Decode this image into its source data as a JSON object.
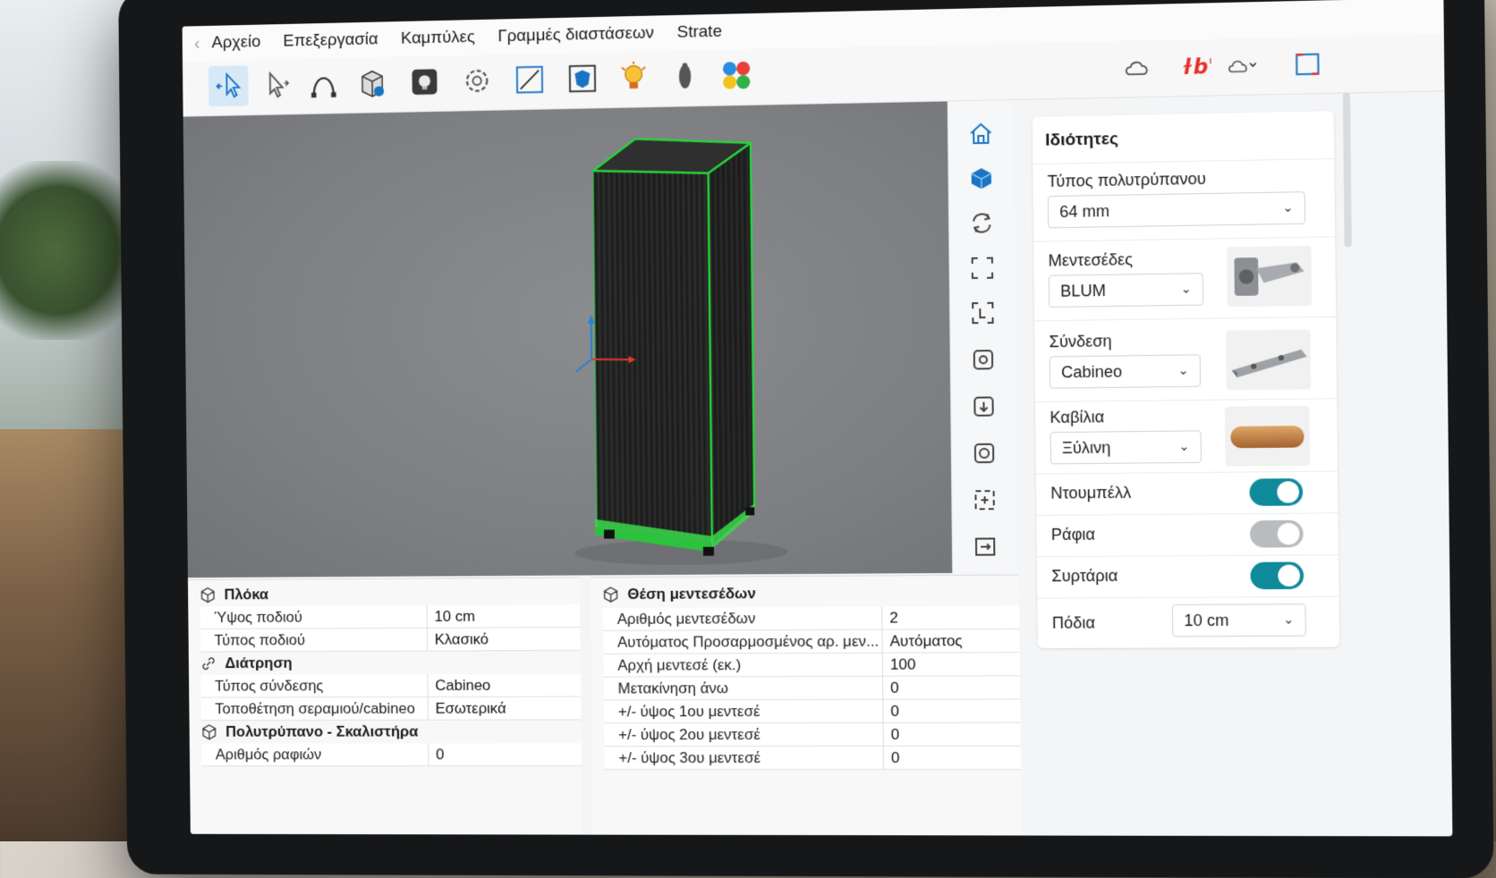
{
  "menu": {
    "items": [
      "Αρχείο",
      "Επεξεργασία",
      "Καμπύλες",
      "Γραμμές διαστάσεων",
      "Strate"
    ]
  },
  "toolbar": {
    "tools": [
      {
        "icon": "select-arrow-icon",
        "active": true
      },
      {
        "icon": "pointer-icon",
        "active": false
      },
      {
        "icon": "curve-icon",
        "active": false
      },
      {
        "icon": "cabinet-icon",
        "active": false
      },
      {
        "icon": "render-icon",
        "active": false
      },
      {
        "icon": "gear-icon",
        "active": false
      },
      {
        "icon": "dimension-icon",
        "active": false
      },
      {
        "icon": "shield-icon",
        "active": false
      },
      {
        "icon": "light-bulb-icon",
        "active": false
      },
      {
        "icon": "figure-icon",
        "active": false
      },
      {
        "icon": "color-palette-icon",
        "active": false
      }
    ],
    "right_tools": [
      "cloud-icon",
      "brand-logo-icon",
      "cloud-sync-icon",
      "fullscreen-icon"
    ]
  },
  "view_tools": [
    "home-icon",
    "cube-view-icon",
    "rotate-icon",
    "frame-icon",
    "frame-select-icon",
    "view-front-icon",
    "view-top-icon",
    "view-side-icon",
    "zoom-fit-icon",
    "zoom-window-icon"
  ],
  "properties": {
    "title": "Ιδιότητες",
    "polytrypano_label": "Τύπος πολυτρύπανου",
    "polytrypano_value": "64 mm",
    "hinges_label": "Μεντεσέδες",
    "hinges_value": "BLUM",
    "connection_label": "Σύνδεση",
    "connection_value": "Cabineo",
    "dowels_label": "Καβίλια",
    "dowels_value": "Ξύλινη",
    "toggles": [
      {
        "label": "Ντουμπέλλ",
        "on": true
      },
      {
        "label": "Ράφια",
        "on": false
      },
      {
        "label": "Συρτάρια",
        "on": true
      }
    ],
    "legs_label": "Πόδια",
    "legs_value": "10 cm"
  },
  "grid_left": {
    "sections": [
      {
        "title": "Πλόκα",
        "rows": [
          [
            "Ύψος ποδιού",
            "10 cm"
          ],
          [
            "Τύπος ποδιού",
            "Κλασικό"
          ]
        ]
      },
      {
        "title": "Διάτρηση",
        "rows": [
          [
            "Τύπος σύνδεσης",
            "Cabineo"
          ],
          [
            "Τοποθέτηση σεραμιού/cabineo",
            "Εσωτερικά"
          ]
        ]
      },
      {
        "title": "Πολυτρύπανο - Σκαλιστήρα",
        "rows": [
          [
            "Αριθμός ραφιών",
            "0"
          ]
        ]
      }
    ]
  },
  "grid_right": {
    "title": "Θέση μεντεσέδων",
    "rows": [
      [
        "Αριθμός μεντεσέδων",
        "2"
      ],
      [
        "Αυτόματος Προσαρμοσμένος αρ. μεν...",
        "Αυτόματος"
      ],
      [
        "Αρχή μεντεσέ (εκ.)",
        "100"
      ],
      [
        "Μετακίνηση άνω",
        "0"
      ],
      [
        "+/- ύψος 1ου μεντεσέ",
        "0"
      ],
      [
        "+/- ύψος 2ου μεντεσέ",
        "0"
      ],
      [
        "+/- ύψος 3ου μεντεσέ",
        "0"
      ]
    ]
  },
  "colors": {
    "accent": "#0e8a9b",
    "selection": "#27d43c",
    "active_tool": "#d7e9f7"
  }
}
